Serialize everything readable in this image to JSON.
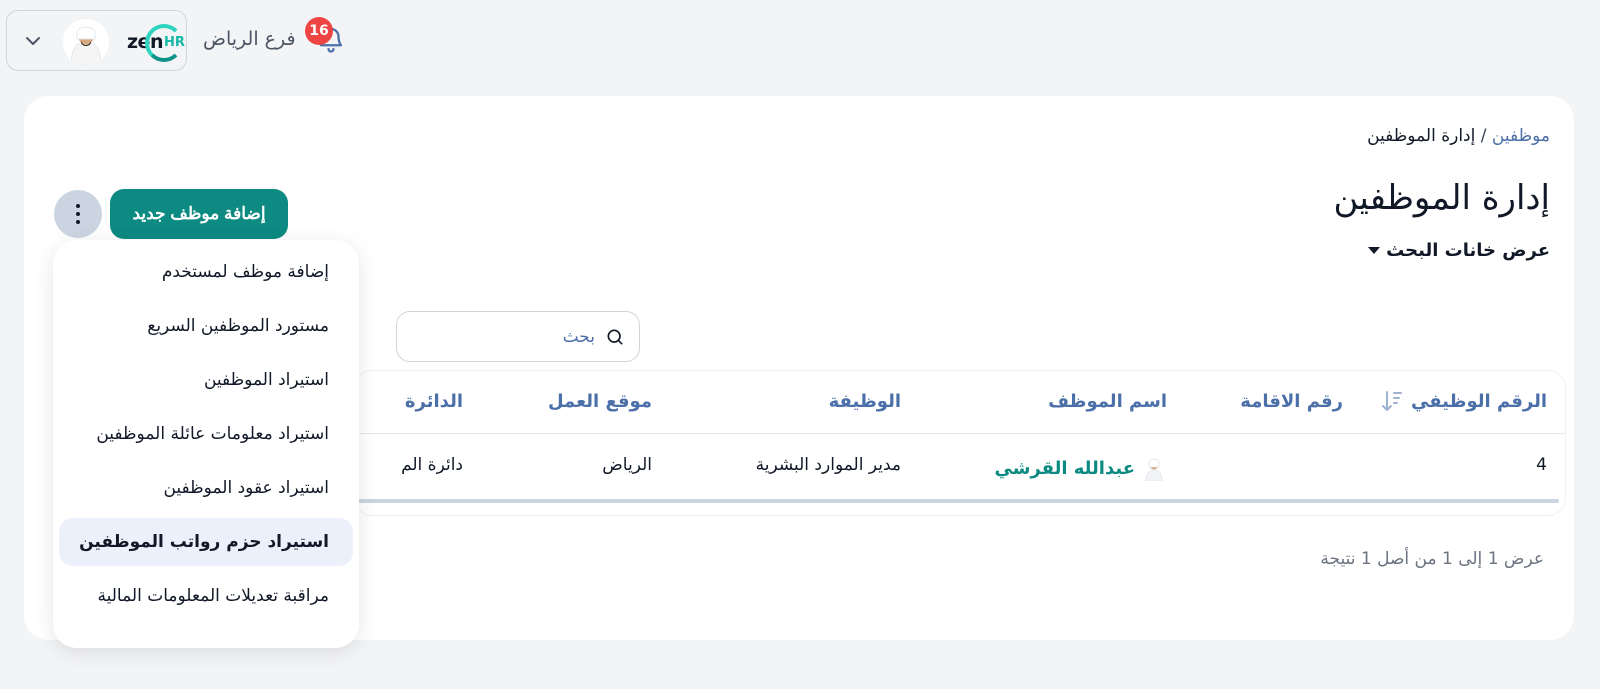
{
  "header": {
    "logo_text_zen": "zen",
    "logo_text_hr": "HR",
    "branch": "فرع الرياض",
    "notification_count": "16"
  },
  "breadcrumb": {
    "parent": "موظفين",
    "separator": "/",
    "current": "إدارة الموظفين"
  },
  "page": {
    "title": "إدارة الموظفين",
    "toggle_search": "عرض خانات البحث",
    "add_button": "إضافة موظف جديد",
    "search_placeholder": "بحث"
  },
  "table": {
    "headers": {
      "employee_number": "الرقم الوظيفي",
      "residence_number": "رقم الاقامة",
      "employee_name": "اسم الموظف",
      "job_title": "الوظيفة",
      "work_location": "موقع العمل",
      "department": "الدائرة"
    },
    "rows": [
      {
        "employee_number": "4",
        "residence_number": "",
        "employee_name": "عبدالله القرشي",
        "job_title": "مدير الموارد البشرية",
        "work_location": "الرياض",
        "department": "دائرة الم"
      }
    ],
    "result_text": "عرض 1 إلى 1 من أصل 1 نتيجة"
  },
  "dropdown": {
    "items": [
      {
        "label": "إضافة موظف لمستخدم",
        "active": false
      },
      {
        "label": "مستورد الموظفين السريع",
        "active": false
      },
      {
        "label": "استيراد الموظفين",
        "active": false
      },
      {
        "label": "استيراد معلومات عائلة الموظفين",
        "active": false
      },
      {
        "label": "استيراد عقود الموظفين",
        "active": false
      },
      {
        "label": "استيراد حزم رواتب الموظفين",
        "active": true
      },
      {
        "label": "مراقبة تعديلات المعلومات المالية",
        "active": false
      }
    ]
  },
  "colors": {
    "primary": "#0d8a82",
    "accent_blue": "#4b6fa8",
    "badge_red": "#ef4444",
    "active_item_bg": "#ecf0fb"
  }
}
